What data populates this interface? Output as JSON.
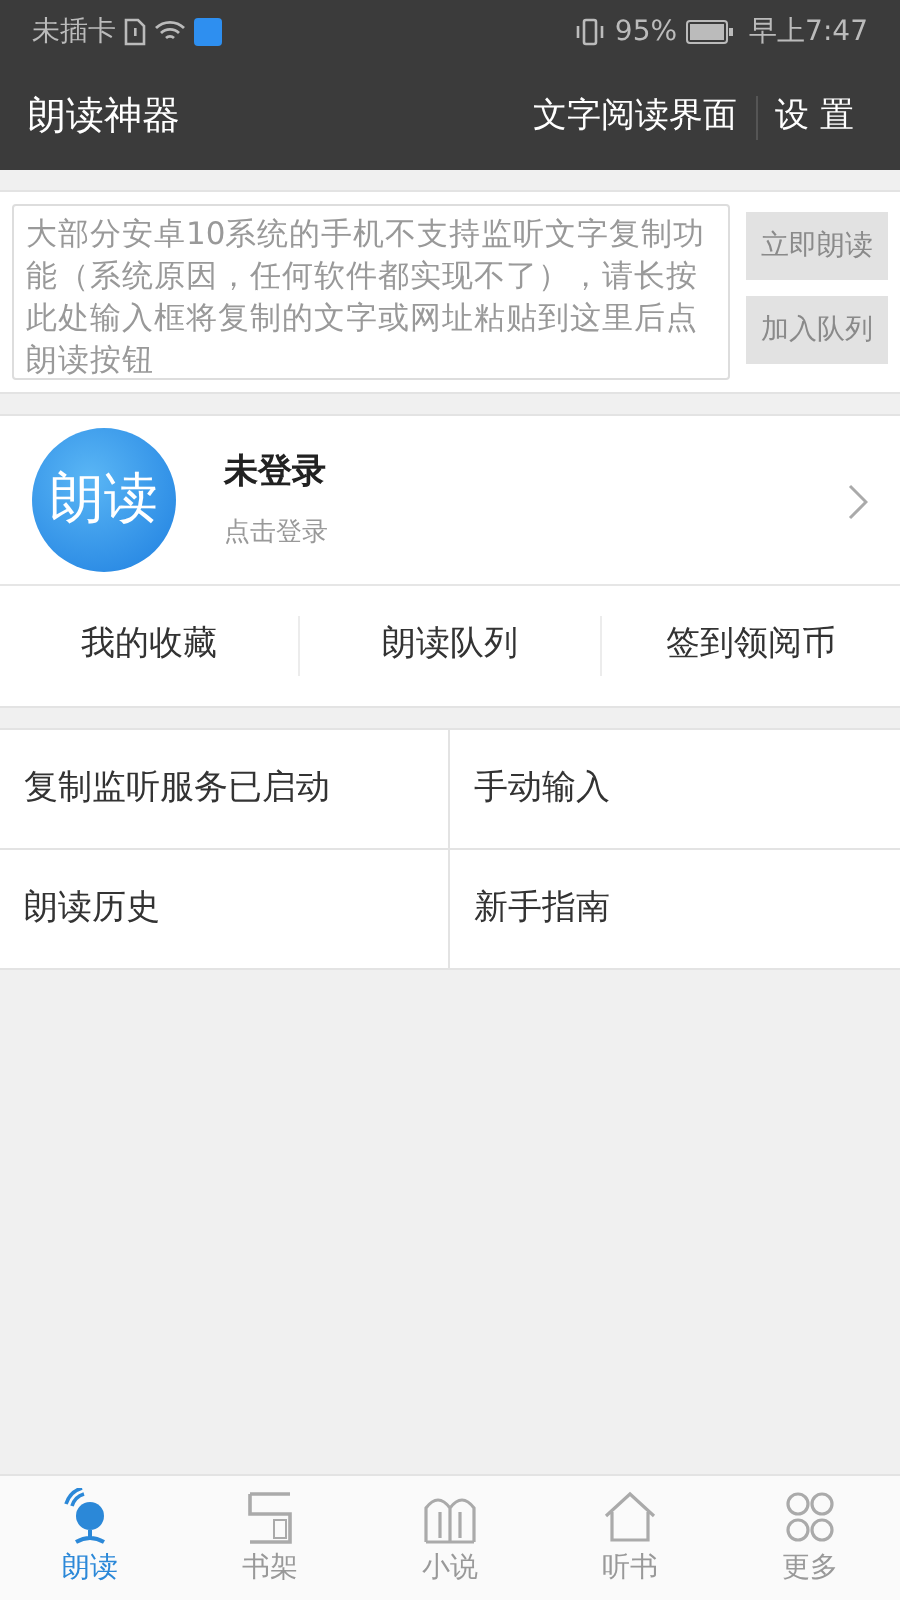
{
  "status_bar": {
    "carrier": "未插卡",
    "battery": "95%",
    "time": "早上7:47"
  },
  "header": {
    "title": "朗读神器",
    "actions": [
      "文字阅读界面",
      "设 置"
    ]
  },
  "input": {
    "placeholder": "大部分安卓10系统的手机不支持监听文字复制功能（系统原因，任何软件都实现不了），请长按此处输入框将复制的文字或网址粘贴到这里后点朗读按钮",
    "buttons": [
      {
        "label": "立即朗读",
        "disabled": true
      },
      {
        "label": "加入队列",
        "disabled": true
      }
    ]
  },
  "profile": {
    "logo_text": "朗读",
    "name": "未登录",
    "hint": "点击登录"
  },
  "shortcuts": [
    "我的收藏",
    "朗读队列",
    "签到领阅币"
  ],
  "menu": [
    "复制监听服务已启动",
    "手动输入",
    "朗读历史",
    "新手指南"
  ],
  "tabs": [
    {
      "label": "朗读",
      "kind": "mic",
      "selected": true
    },
    {
      "label": "书架",
      "kind": "shelf",
      "selected": false
    },
    {
      "label": "小说",
      "kind": "book",
      "selected": false
    },
    {
      "label": "听书",
      "kind": "house",
      "selected": false
    },
    {
      "label": "更多",
      "kind": "more",
      "selected": false
    }
  ]
}
